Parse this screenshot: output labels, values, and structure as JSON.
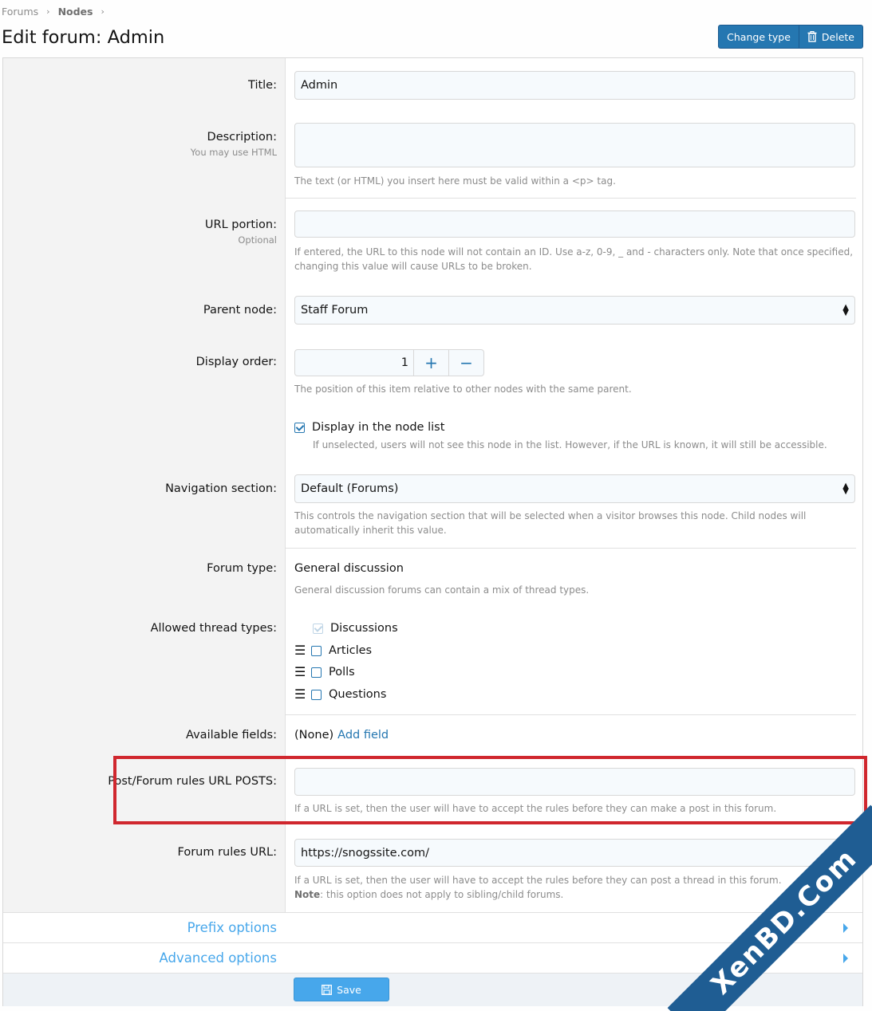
{
  "breadcrumb": {
    "items": [
      "Forums",
      "Nodes"
    ]
  },
  "page_title": "Edit forum: Admin",
  "actions": {
    "change_type": "Change type",
    "delete": "Delete"
  },
  "form": {
    "title": {
      "label": "Title:",
      "value": "Admin"
    },
    "description": {
      "label": "Description:",
      "hint": "You may use HTML",
      "value": "",
      "explain": "The text (or HTML) you insert here must be valid within a <p> tag."
    },
    "url_portion": {
      "label": "URL portion:",
      "hint": "Optional",
      "value": "",
      "explain": "If entered, the URL to this node will not contain an ID. Use a-z, 0-9, _ and - characters only. Note that once specified, changing this value will cause URLs to be broken."
    },
    "parent_node": {
      "label": "Parent node:",
      "value": "Staff Forum"
    },
    "display_order": {
      "label": "Display order:",
      "value": "1",
      "plus": "+",
      "minus": "−",
      "explain": "The position of this item relative to other nodes with the same parent."
    },
    "display_in_list": {
      "label": "Display in the node list",
      "checked": true,
      "explain": "If unselected, users will not see this node in the list. However, if the URL is known, it will still be accessible."
    },
    "navigation": {
      "label": "Navigation section:",
      "value": "Default (Forums)",
      "explain": "This controls the navigation section that will be selected when a visitor browses this node. Child nodes will automatically inherit this value."
    },
    "forum_type": {
      "label": "Forum type:",
      "value": "General discussion",
      "explain": "General discussion forums can contain a mix of thread types."
    },
    "thread_types": {
      "label": "Allowed thread types:",
      "items": [
        {
          "label": "Discussions",
          "checked": true,
          "disabled": true
        },
        {
          "label": "Articles",
          "checked": false
        },
        {
          "label": "Polls",
          "checked": false
        },
        {
          "label": "Questions",
          "checked": false
        }
      ]
    },
    "available_fields": {
      "label": "Available fields:",
      "none": "(None)",
      "add": "Add field"
    },
    "post_rules": {
      "label": "Post/Forum rules URL POSTS:",
      "value": "",
      "explain": "If a URL is set, then the user will have to accept the rules before they can make a post in this forum."
    },
    "forum_rules": {
      "label": "Forum rules URL:",
      "value": "https://snogssite.com/",
      "explain": "If a URL is set, then the user will have to accept the rules before they can post a thread in this forum.",
      "note_label": "Note",
      "note": ": this option does not apply to sibling/child forums."
    }
  },
  "sections": {
    "prefix": "Prefix options",
    "advanced": "Advanced options"
  },
  "save": "Save",
  "watermark": "XenBD.Com",
  "colors": {
    "accent": "#2577b1",
    "link": "#47a7eb",
    "highlight": "#d0272e",
    "watermark": "#1f5d93"
  }
}
